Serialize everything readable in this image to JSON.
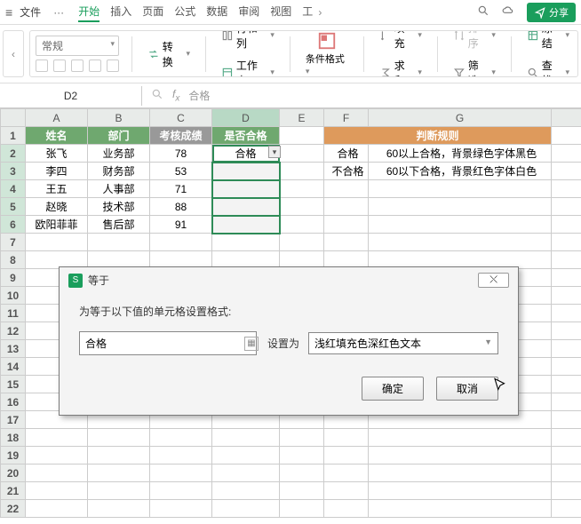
{
  "menu": {
    "file": "文件",
    "tabs": [
      "开始",
      "插入",
      "页面",
      "公式",
      "数据",
      "审阅",
      "视图",
      "工"
    ],
    "active": 0,
    "share": "分享"
  },
  "ribbon": {
    "format": "常规",
    "convert": "转换",
    "rowcol": "行和列",
    "worksheet": "工作表",
    "condfmt": "条件格式",
    "fill": "填充",
    "sum": "求和",
    "sort": "排序",
    "filter": "筛选",
    "freeze": "冻结",
    "find": "查找"
  },
  "fbar": {
    "name": "D2",
    "value": "合格"
  },
  "cols": [
    "A",
    "B",
    "C",
    "D",
    "E",
    "F",
    "G"
  ],
  "headers": {
    "name": "姓名",
    "dept": "部门",
    "score": "考核成绩",
    "pass": "是否合格",
    "rules": "判断规则"
  },
  "rows": [
    {
      "name": "张飞",
      "dept": "业务部",
      "score": "78",
      "pass": "合格"
    },
    {
      "name": "李四",
      "dept": "财务部",
      "score": "53",
      "pass": ""
    },
    {
      "name": "王五",
      "dept": "人事部",
      "score": "71",
      "pass": ""
    },
    {
      "name": "赵晓",
      "dept": "技术部",
      "score": "88",
      "pass": ""
    },
    {
      "name": "欧阳菲菲",
      "dept": "售后部",
      "score": "91",
      "pass": ""
    }
  ],
  "rules": [
    {
      "k": "合格",
      "v": "60以上合格，背景绿色字体黑色"
    },
    {
      "k": "不合格",
      "v": "60以下合格，背景红色字体白色"
    }
  ],
  "dialog": {
    "title": "等于",
    "prompt": "为等于以下值的单元格设置格式:",
    "value": "合格",
    "setlabel": "设置为",
    "preset": "浅红填充色深红色文本",
    "ok": "确定",
    "cancel": "取消",
    "close": "✕"
  }
}
